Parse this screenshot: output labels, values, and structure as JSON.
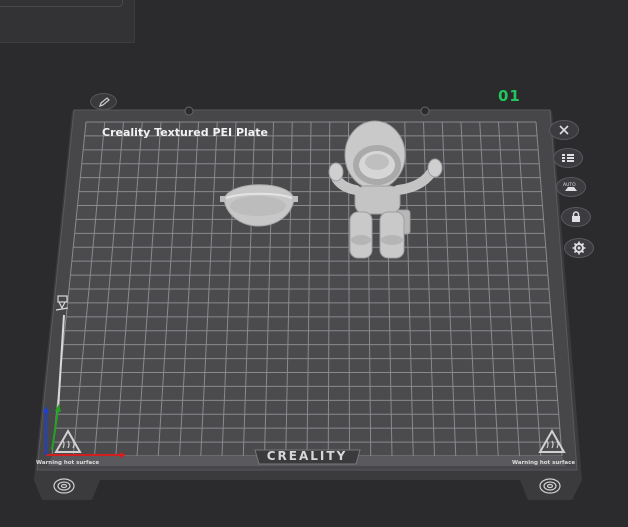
{
  "plate": {
    "number": "01",
    "label": "Creality Textured PEI Plate",
    "brand": "CREALITY",
    "warning_left": "Warning hot surface",
    "warning_right": "Warning hot surface"
  },
  "toolbar": {
    "edit_icon": "pencil-icon",
    "buttons": [
      {
        "name": "close-icon"
      },
      {
        "name": "list-icon"
      },
      {
        "name": "auto-arrange-icon",
        "text": "AUTO"
      },
      {
        "name": "lock-icon"
      },
      {
        "name": "gear-icon"
      }
    ]
  },
  "colors": {
    "background": "#2b2b2d",
    "plate": "#4a4a4d",
    "grid": "#8a8a8e",
    "model": "#c9c9c9",
    "plate_number": "#22c55e",
    "axis_x": "#d11f1f",
    "axis_y": "#1fa51f",
    "axis_z": "#1f3fd1"
  }
}
